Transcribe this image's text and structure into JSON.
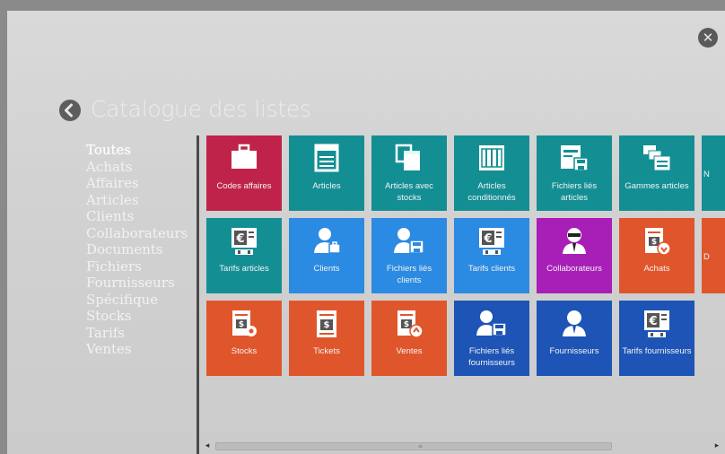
{
  "header": {
    "title": "Catalogue des listes",
    "close_icon": "close-icon",
    "back_icon": "back-arrow-icon"
  },
  "categories": [
    {
      "label": "Toutes",
      "active": true
    },
    {
      "label": "Achats",
      "active": false
    },
    {
      "label": "Affaires",
      "active": false
    },
    {
      "label": "Articles",
      "active": false
    },
    {
      "label": "Clients",
      "active": false
    },
    {
      "label": "Collaborateurs",
      "active": false
    },
    {
      "label": "Documents",
      "active": false
    },
    {
      "label": "Fichiers",
      "active": false
    },
    {
      "label": "Fournisseurs",
      "active": false
    },
    {
      "label": "Spécifique",
      "active": false
    },
    {
      "label": "Stocks",
      "active": false
    },
    {
      "label": "Tarifs",
      "active": false
    },
    {
      "label": "Ventes",
      "active": false
    }
  ],
  "colors": {
    "crimson": "#c0234a",
    "teal": "#138f94",
    "blue": "#2b8ae2",
    "purple": "#a81fb8",
    "orange": "#e0562c",
    "navy": "#1d54b5"
  },
  "tiles": [
    [
      {
        "label": "Codes affaires",
        "color": "crimson",
        "icon": "briefcase-icon"
      },
      {
        "label": "Articles",
        "color": "teal",
        "icon": "article-icon"
      },
      {
        "label": "Articles avec stocks",
        "color": "teal",
        "icon": "stacked-articles-icon"
      },
      {
        "label": "Articles conditionnés",
        "color": "teal",
        "icon": "crate-icon"
      },
      {
        "label": "Fichiers liés articles",
        "color": "teal",
        "icon": "linked-file-icon"
      },
      {
        "label": "Gammes articles",
        "color": "teal",
        "icon": "ranges-icon"
      },
      {
        "label": "N",
        "color": "teal",
        "icon": ""
      }
    ],
    [
      {
        "label": "Tarifs articles",
        "color": "teal",
        "icon": "price-screen-icon"
      },
      {
        "label": "Clients",
        "color": "blue",
        "icon": "client-icon"
      },
      {
        "label": "Fichiers liés clients",
        "color": "blue",
        "icon": "client-file-icon"
      },
      {
        "label": "Tarifs clients",
        "color": "blue",
        "icon": "price-screen-icon"
      },
      {
        "label": "Collaborateurs",
        "color": "purple",
        "icon": "agent-icon"
      },
      {
        "label": "Achats",
        "color": "orange",
        "icon": "purchase-doc-icon"
      },
      {
        "label": "D",
        "color": "orange",
        "icon": ""
      }
    ],
    [
      {
        "label": "Stocks",
        "color": "orange",
        "icon": "stock-doc-icon"
      },
      {
        "label": "Tickets",
        "color": "orange",
        "icon": "ticket-doc-icon"
      },
      {
        "label": "Ventes",
        "color": "orange",
        "icon": "sale-doc-icon"
      },
      {
        "label": "Fichiers liés fournisseurs",
        "color": "navy",
        "icon": "supplier-file-icon"
      },
      {
        "label": "Fournisseurs",
        "color": "navy",
        "icon": "supplier-icon"
      },
      {
        "label": "Tarifs fournisseurs",
        "color": "navy",
        "icon": "price-screen-icon"
      }
    ]
  ],
  "scrollbar": {
    "left_arrow": "◂",
    "right_arrow": "▸",
    "grip": "≡"
  }
}
